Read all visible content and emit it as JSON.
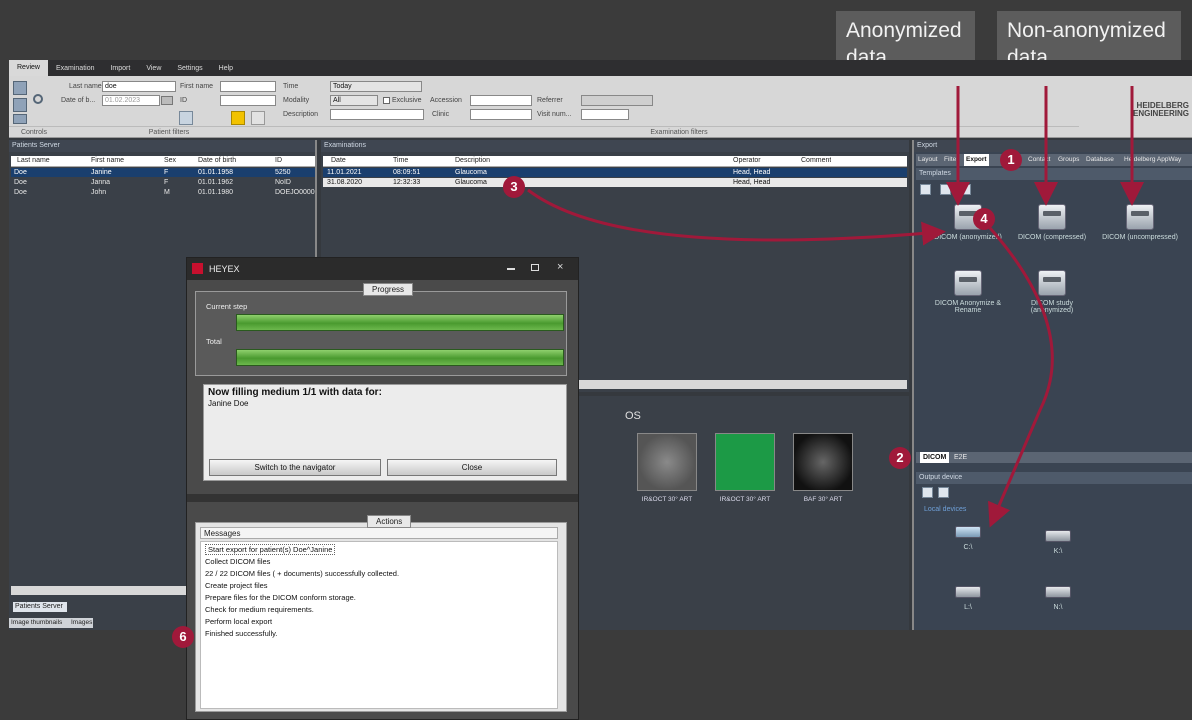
{
  "callouts": {
    "anonymized": "Anonymized\ndata",
    "non_anonymized": "Non-anonymized\ndata"
  },
  "badges": [
    "1",
    "2",
    "3",
    "4",
    "6"
  ],
  "menu": [
    "Review",
    "Examination",
    "Import",
    "View",
    "Settings",
    "Help"
  ],
  "patient_filters": {
    "last_name_label": "Last name",
    "last_name_value": "doe",
    "first_name_label": "First name",
    "dob_label": "Date of b...",
    "dob_value": "01.02.2023",
    "id_label": "ID",
    "section": "Patient filters",
    "controls": "Controls"
  },
  "exam_filters": {
    "time_label": "Time",
    "time_value": "Today",
    "modality_label": "Modality",
    "modality_value": "All",
    "exclusive_label": "Exclusive",
    "accession_label": "Accession",
    "referrer_label": "Referrer",
    "description_label": "Description",
    "clinic_label": "Clinic",
    "visit_label": "Visit num...",
    "section": "Examination filters"
  },
  "brand": "HEIDELBERG\nENGINEERING",
  "patients": {
    "title": "Patients Server",
    "columns": [
      "Last name",
      "First name",
      "Sex",
      "Date of birth",
      "ID"
    ],
    "rows": [
      [
        "Doe",
        "Janine",
        "F",
        "01.01.1958",
        "5250"
      ],
      [
        "Doe",
        "Janna",
        "F",
        "01.01.1962",
        "NoID"
      ],
      [
        "Doe",
        "John",
        "M",
        "01.01.1980",
        "DOEJO0000"
      ]
    ],
    "bottom_tab": "Patients Server",
    "status_tabs": [
      "Image thumbnails",
      "Images"
    ]
  },
  "examinations": {
    "title": "Examinations",
    "columns": [
      "Date",
      "Time",
      "Description",
      "Operator",
      "Comment"
    ],
    "rows": [
      [
        "11.01.2021",
        "08:09:51",
        "Glaucoma",
        "Head, Head",
        ""
      ],
      [
        "31.08.2020",
        "12:32:33",
        "Glaucoma",
        "Head, Head",
        ""
      ]
    ]
  },
  "images": {
    "eye": "OS",
    "thumbs": [
      "IR&OCT 30° ART",
      "IR&OCT 30° ART",
      "BAF 30° ART"
    ]
  },
  "export": {
    "title": "Export",
    "tabs": [
      "Layout",
      "Filter",
      "Export",
      "Contact",
      "Groups",
      "Database",
      "Heidelberg AppWay"
    ],
    "templates_title": "Templates",
    "templates": [
      "DICOM (anonymized)",
      "DICOM (compressed)",
      "DICOM (uncompressed)",
      "DICOM Anonymize & Rename",
      "DICOM study (anonymized)"
    ],
    "format_tabs": [
      "DICOM",
      "E2E"
    ],
    "output_title": "Output device",
    "devices_title": "Local devices",
    "drives": [
      "C:\\",
      "K:\\",
      "L:\\",
      "N:\\"
    ]
  },
  "dialog": {
    "title": "HEYEX",
    "progress": "Progress",
    "current_step": "Current step",
    "total": "Total",
    "current_pct": 1.0,
    "total_pct": 1.0,
    "status_heading": "Now filling medium 1/1 with data for:",
    "status_patient": "Janine Doe",
    "switch_btn": "Switch to the navigator",
    "close_btn": "Close",
    "actions": "Actions",
    "messages_header": "Messages",
    "messages": [
      "Start export for patient(s) Doe^Janine",
      "Collect DICOM files",
      "22 / 22 DICOM files ( + documents) successfully collected.",
      "Create project files",
      "Prepare files for the DICOM conform storage.",
      "Check for medium requirements.",
      "Perform local export",
      "Finished successfully."
    ]
  },
  "colors": {
    "accent": "#a0193a",
    "selection": "#1a3f6e",
    "progress": "#4a9a2f"
  }
}
